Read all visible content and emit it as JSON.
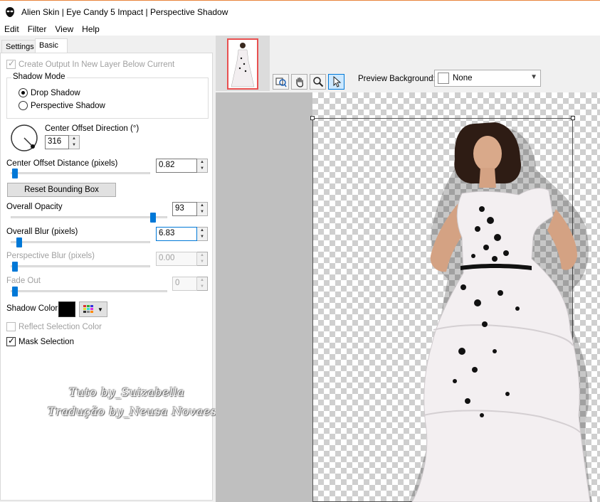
{
  "window": {
    "title": "Alien Skin | Eye Candy 5 Impact | Perspective Shadow"
  },
  "menu": [
    "Edit",
    "Filter",
    "View",
    "Help"
  ],
  "tabs": {
    "settings": "Settings",
    "basic": "Basic"
  },
  "options": {
    "create_output": {
      "label": "Create Output In New Layer Below Current",
      "checked": true,
      "enabled": false
    },
    "shadow_mode": {
      "legend": "Shadow Mode",
      "drop": "Drop Shadow",
      "perspective": "Perspective Shadow",
      "selected": "Drop Shadow"
    },
    "center_offset_direction": {
      "label": "Center Offset Direction (°)",
      "value": "316"
    },
    "center_offset_distance": {
      "label": "Center Offset Distance (pixels)",
      "value": "0.82",
      "slider_fraction": 0.02
    },
    "reset_button": "Reset Bounding Box",
    "overall_opacity": {
      "label": "Overall Opacity",
      "value": "93",
      "slider_fraction": 0.93
    },
    "overall_blur": {
      "label": "Overall Blur (pixels)",
      "value": "6.83",
      "slider_fraction": 0.04
    },
    "perspective_blur": {
      "label": "Perspective Blur (pixels)",
      "value": "0.00",
      "slider_fraction": 0.0
    },
    "fade_out": {
      "label": "Fade Out",
      "value": "0",
      "slider_fraction": 0.0
    },
    "shadow_color": {
      "label": "Shadow Color",
      "color": "#000000"
    },
    "reflect_selection_color": {
      "label": "Reflect Selection Color",
      "checked": false,
      "enabled": false
    },
    "mask_selection": {
      "label": "Mask Selection",
      "checked": true
    }
  },
  "watermark": {
    "line1": "Tuto by_Suizabella",
    "line2": "Tradução by_Neusa Novaes"
  },
  "preview": {
    "background_label": "Preview Background:",
    "background_value": "None",
    "tools": [
      "preview-toggle-icon",
      "hand-icon",
      "zoom-icon",
      "arrow-icon"
    ]
  },
  "colors": {
    "accent": "#0078d7",
    "thumbnail_border": "#e85050",
    "title_accent": "#e8843c"
  }
}
